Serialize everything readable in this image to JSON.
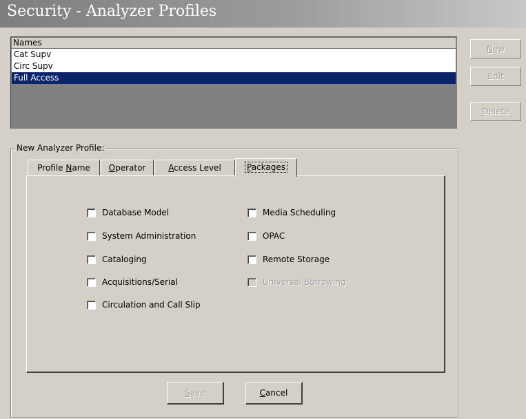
{
  "window": {
    "title": "Security - Analyzer Profiles"
  },
  "names_list": {
    "header": "Names",
    "items": [
      {
        "label": "Cat Supv",
        "selected": false
      },
      {
        "label": "Circ Supv",
        "selected": false
      },
      {
        "label": "Full Access",
        "selected": true
      }
    ]
  },
  "side_buttons": {
    "new": {
      "label": "New",
      "mnemonic": "N",
      "rest": "ew",
      "enabled": false
    },
    "edit": {
      "label": "Edit",
      "mnemonic": "E",
      "rest": "dit",
      "enabled": false
    },
    "delete": {
      "label": "Delete",
      "mnemonic": "D",
      "rest": "elete",
      "enabled": false
    }
  },
  "profile_group": {
    "label": "New  Analyzer Profile:",
    "tabs": [
      {
        "pre": "Profile ",
        "mnemonic": "N",
        "post": "ame"
      },
      {
        "pre": "",
        "mnemonic": "O",
        "post": "perator"
      },
      {
        "pre": "",
        "mnemonic": "A",
        "post": "ccess Level"
      },
      {
        "pre": "",
        "mnemonic": "P",
        "post": "ackages",
        "active": true
      }
    ],
    "packages": {
      "left": [
        {
          "label": "Database Model",
          "checked": false,
          "enabled": true
        },
        {
          "label": "System Administration",
          "checked": false,
          "enabled": true
        },
        {
          "label": "Cataloging",
          "checked": false,
          "enabled": true
        },
        {
          "label": "Acquisitions/Serial",
          "checked": false,
          "enabled": true
        },
        {
          "label": "Circulation and Call Slip",
          "checked": false,
          "enabled": true
        }
      ],
      "right": [
        {
          "label": "Media Scheduling",
          "checked": false,
          "enabled": true
        },
        {
          "label": "OPAC",
          "checked": false,
          "enabled": true
        },
        {
          "label": "Remote Storage",
          "checked": false,
          "enabled": true
        },
        {
          "label": "Universal Borrowing",
          "checked": false,
          "enabled": false
        }
      ]
    }
  },
  "buttons": {
    "save": {
      "mnemonic": "S",
      "rest": "ave",
      "enabled": false
    },
    "cancel": {
      "mnemonic": "C",
      "rest": "ancel",
      "enabled": true
    }
  },
  "colors": {
    "face": "#d4d0c8",
    "selection": "#0a246a",
    "disabled_text": "#a0a0a0"
  }
}
